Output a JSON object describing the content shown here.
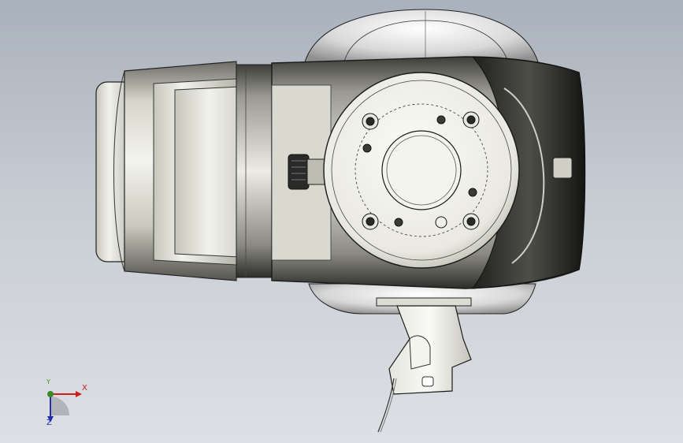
{
  "viewport": {
    "background_top": "#a9b1bc",
    "background_bottom": "#dde0e4"
  },
  "triad": {
    "x_label": "X",
    "y_label": "Y",
    "z_label": "Z",
    "x_color": "#cc1d1d",
    "y_color": "#3a8a2a",
    "z_color": "#1f2fb0"
  }
}
